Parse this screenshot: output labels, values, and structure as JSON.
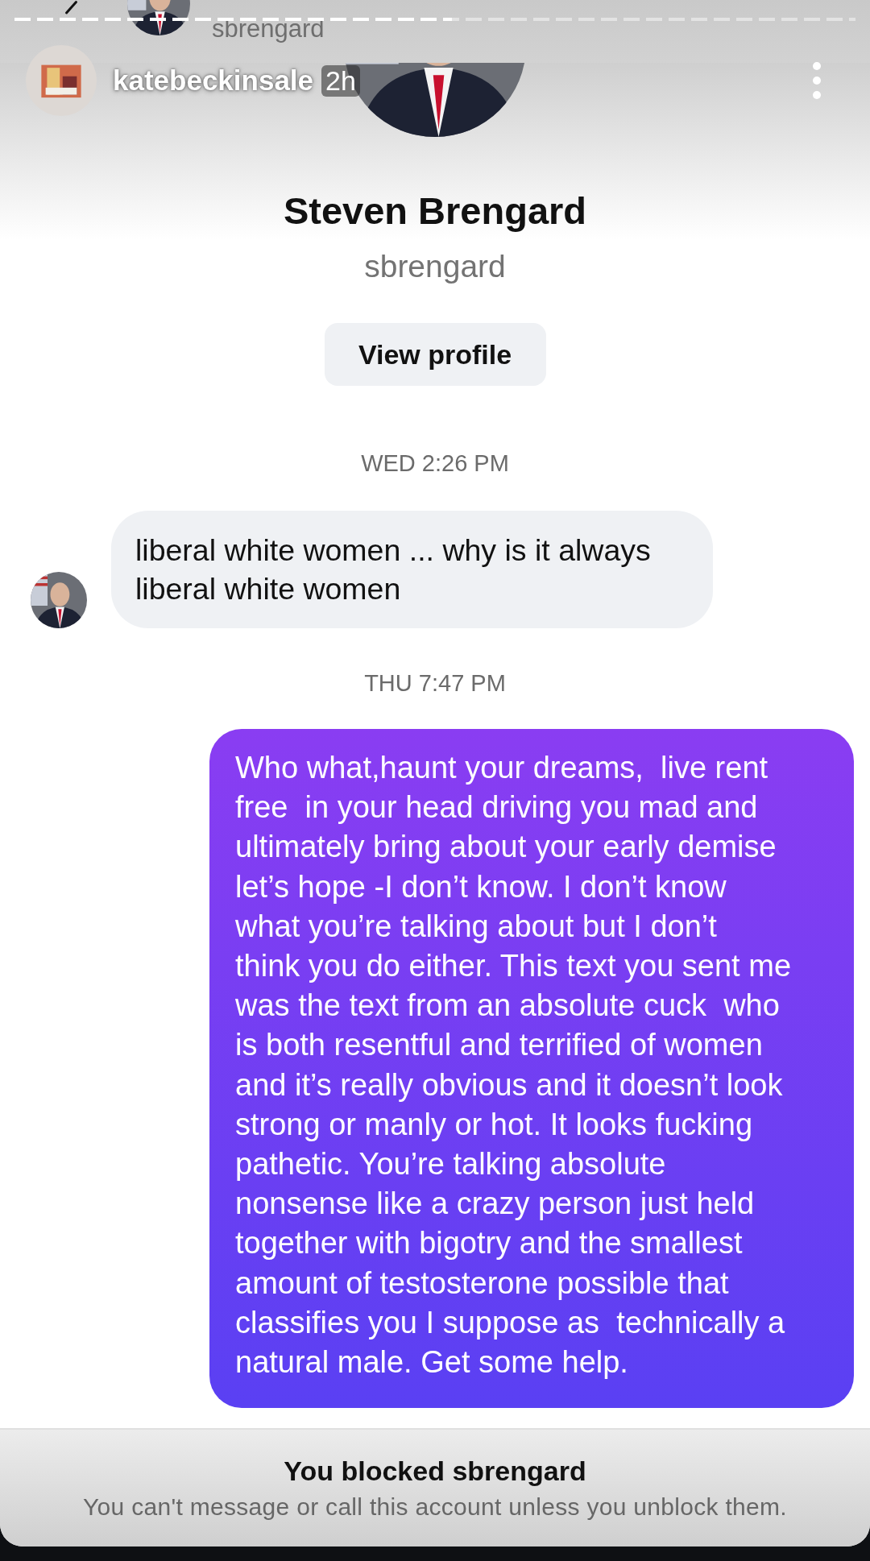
{
  "story": {
    "progress": {
      "level": 0.52
    },
    "author": "katebeckinsale",
    "time": "2h"
  },
  "chat_header": {
    "username": "sbrengard"
  },
  "profile": {
    "name": "Steven Brengard",
    "username": "sbrengard",
    "button": "View profile"
  },
  "messages": [
    {
      "kind": "timestamp",
      "text": "WED 2:26 PM"
    },
    {
      "kind": "incoming",
      "text": "liberal white women ... why is it always\nliberal white women"
    },
    {
      "kind": "timestamp",
      "text": "THU 7:47 PM"
    },
    {
      "kind": "outgoing",
      "text": "Who what,haunt your dreams,  live rent\nfree  in your head driving you mad and\nultimately bring about your early demise\nlet’s hope -I don’t know. I don’t know\nwhat you’re talking about but I don’t\nthink you do either. This text you sent me\nwas the text from an absolute cuck  who\nis both resentful and terrified of women\nand it’s really obvious and it doesn’t look\nstrong or manly or hot. It looks fucking\npathetic. You’re talking absolute\nnonsense like a crazy person just held\ntogether with bigotry and the smallest\namount of testosterone possible that\nclassifies you I suppose as  technically a\nnatural male. Get some help."
    }
  ],
  "blocked": {
    "title": "You blocked sbrengard",
    "subtitle": "You can't message or call this account unless you unblock them."
  }
}
